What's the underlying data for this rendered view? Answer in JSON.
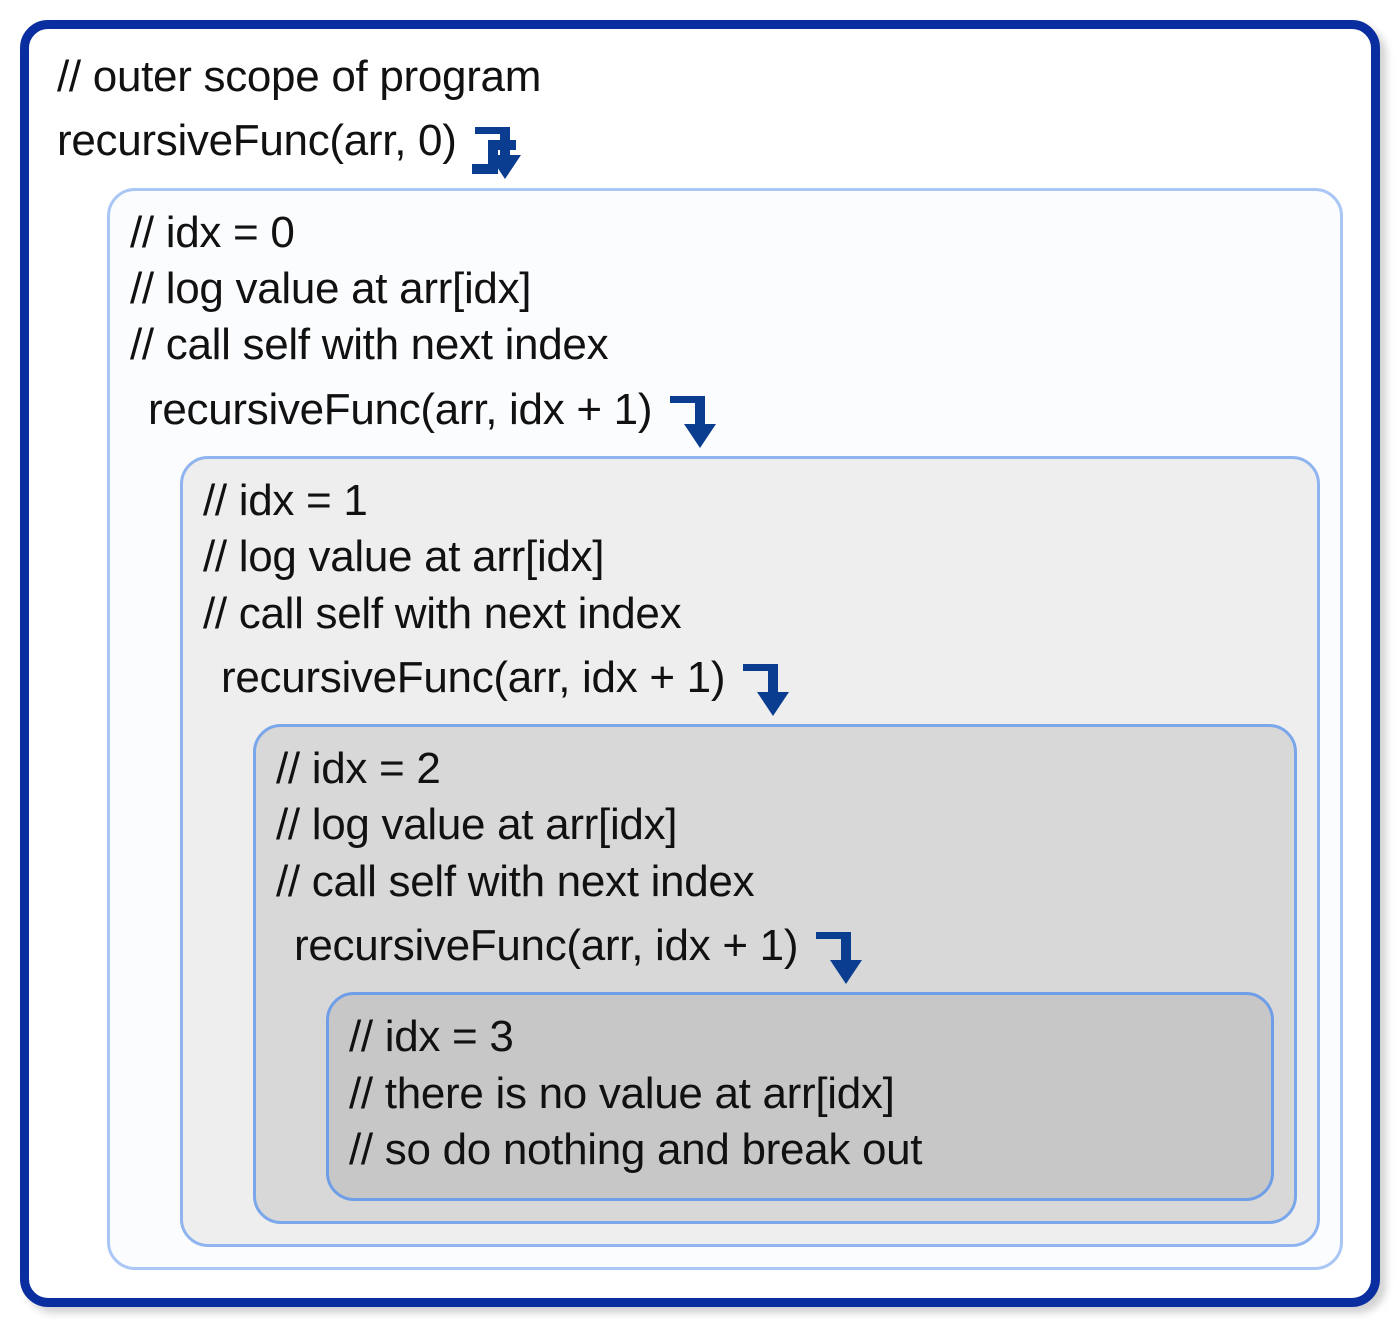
{
  "outer": {
    "comment1": "// outer scope of program",
    "call": "recursiveFunc(arr, 0)"
  },
  "lvl0": {
    "l1": "// idx = 0",
    "l2": "// log value at arr[idx]",
    "l3": "// call self with next index",
    "call": "recursiveFunc(arr, idx + 1)"
  },
  "lvl1": {
    "l1": "// idx = 1",
    "l2": "// log value at arr[idx]",
    "l3": "// call self with next index",
    "call": "recursiveFunc(arr, idx + 1)"
  },
  "lvl2": {
    "l1": "// idx = 2",
    "l2": "// log value at arr[idx]",
    "l3": "// call self with next index",
    "call": "recursiveFunc(arr, idx + 1)"
  },
  "lvl3": {
    "l1": "// idx = 3",
    "l2": "// there is no value at arr[idx]",
    "l3": "// so do nothing and break out"
  },
  "colors": {
    "outer_border": "#0a2ea0",
    "arrow": "#0a3d8f"
  }
}
